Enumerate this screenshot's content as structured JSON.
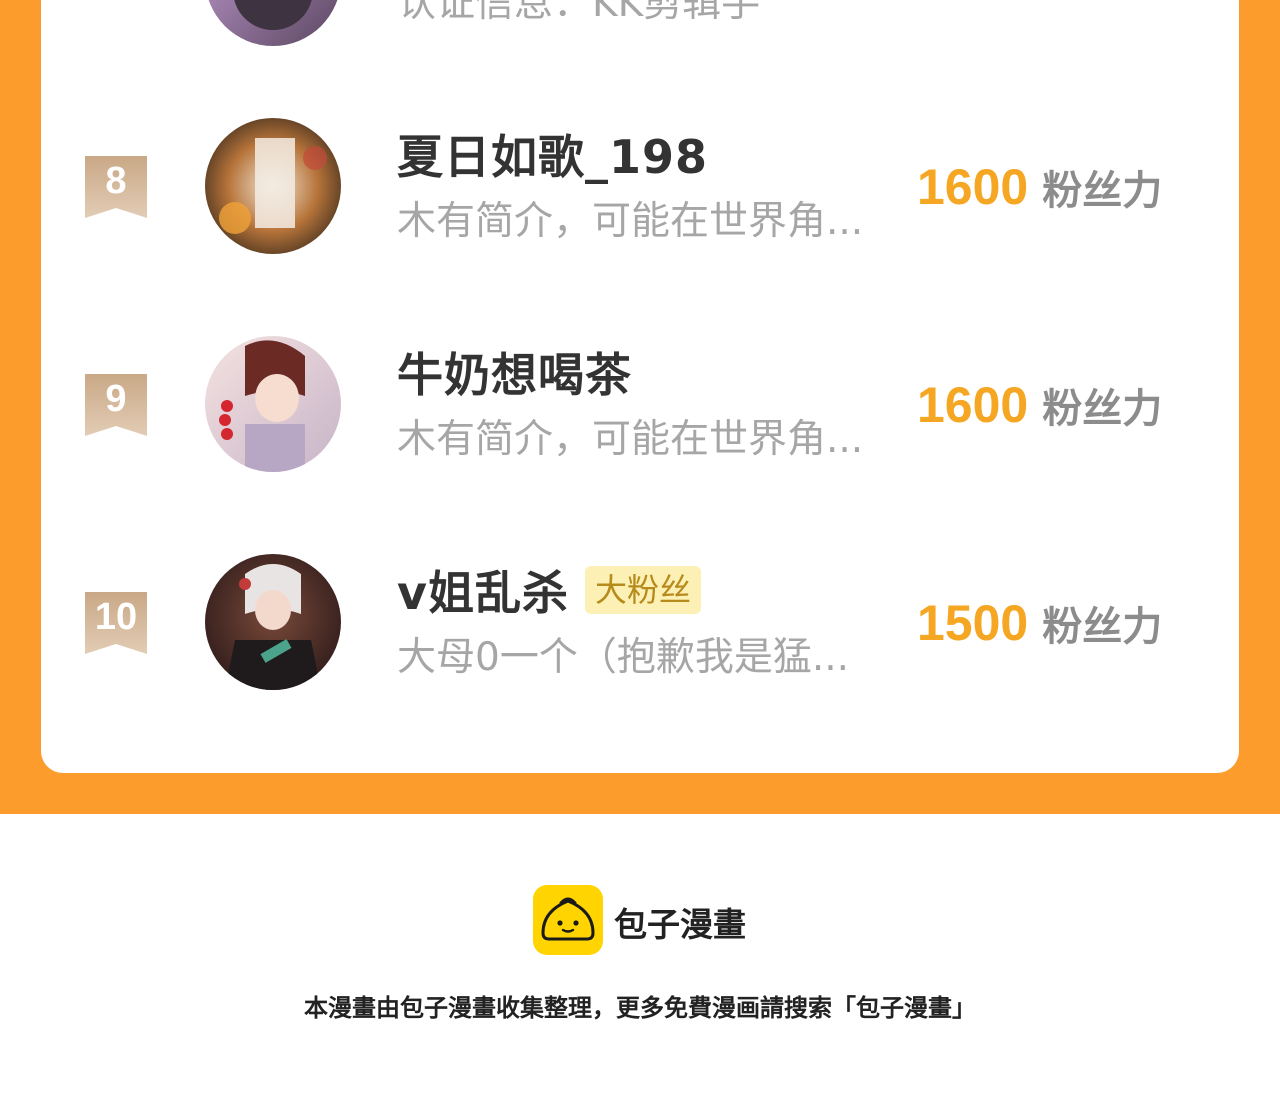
{
  "ranking": {
    "partial_top_row": {
      "desc": "认证信息：KK剪辑手"
    },
    "rows": [
      {
        "rank": "8",
        "name": "夏日如歌_198",
        "tag": "",
        "desc": "木有简介，可能在世界角...",
        "score": "1600",
        "unit": "粉丝力"
      },
      {
        "rank": "9",
        "name": "牛奶想喝茶",
        "tag": "",
        "desc": "木有简介，可能在世界角...",
        "score": "1600",
        "unit": "粉丝力"
      },
      {
        "rank": "10",
        "name": "v姐乱杀",
        "tag": "大粉丝",
        "desc": "大母0一个（抱歉我是猛...",
        "score": "1500",
        "unit": "粉丝力"
      }
    ]
  },
  "footer": {
    "brand": "包子漫畫",
    "note": "本漫畫由包子漫畫收集整理，更多免費漫画請搜索「包子漫畫」",
    "logo_icon": "bun-logo-icon"
  },
  "colors": {
    "frame": "#fb9c2c",
    "score": "#f5a623",
    "badge": "#d4b89a",
    "tag_bg": "#fdf0b4",
    "logo_bg": "#ffd400"
  }
}
